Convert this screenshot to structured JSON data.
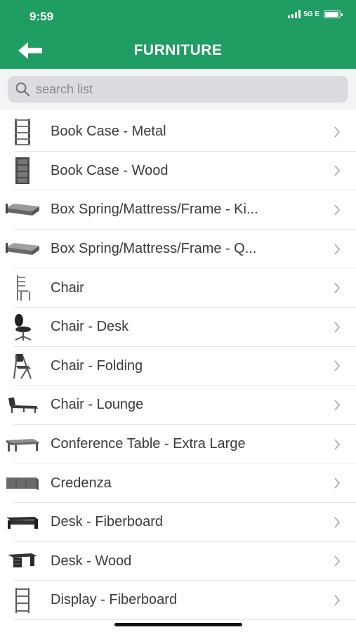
{
  "status": {
    "time": "9:59",
    "network": "5G E"
  },
  "header": {
    "title": "FURNITURE",
    "back_icon": "arrow-left-icon"
  },
  "search": {
    "placeholder": "search list",
    "value": ""
  },
  "items": [
    {
      "label": "Book Case - Metal",
      "icon": "bookcase-metal-icon"
    },
    {
      "label": "Book Case - Wood",
      "icon": "bookcase-wood-icon"
    },
    {
      "label": "Box Spring/Mattress/Frame - Ki...",
      "icon": "bed-king-icon"
    },
    {
      "label": "Box Spring/Mattress/Frame - Q...",
      "icon": "bed-queen-icon"
    },
    {
      "label": "Chair",
      "icon": "chair-icon"
    },
    {
      "label": "Chair - Desk",
      "icon": "desk-chair-icon"
    },
    {
      "label": "Chair - Folding",
      "icon": "folding-chair-icon"
    },
    {
      "label": "Chair - Lounge",
      "icon": "lounge-chair-icon"
    },
    {
      "label": "Conference Table - Extra Large",
      "icon": "conference-table-icon"
    },
    {
      "label": "Credenza",
      "icon": "credenza-icon"
    },
    {
      "label": "Desk - Fiberboard",
      "icon": "desk-fiberboard-icon"
    },
    {
      "label": "Desk - Wood",
      "icon": "desk-wood-icon"
    },
    {
      "label": "Display - Fiberboard",
      "icon": "display-fiberboard-icon"
    }
  ],
  "colors": {
    "brand_green": "#1f9d63",
    "search_bg": "#dcdce0",
    "text": "#3a3a3a"
  }
}
